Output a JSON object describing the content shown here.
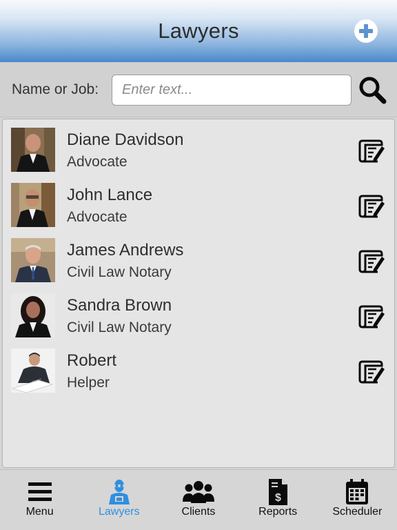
{
  "header": {
    "title": "Lawyers",
    "add_icon": "plus-circle-icon"
  },
  "search": {
    "label": "Name or Job:",
    "placeholder": "Enter text...",
    "value": "",
    "icon": "search-icon"
  },
  "lawyers": [
    {
      "name": "Diane Davidson",
      "job": "Advocate"
    },
    {
      "name": "John Lance",
      "job": "Advocate"
    },
    {
      "name": "James Andrews",
      "job": "Civil Law Notary"
    },
    {
      "name": "Sandra Brown",
      "job": "Civil Law Notary"
    },
    {
      "name": "Robert",
      "job": "Helper"
    }
  ],
  "tabs": [
    {
      "label": "Menu",
      "icon": "hamburger-menu-icon",
      "active": false
    },
    {
      "label": "Lawyers",
      "icon": "lawyer-icon",
      "active": true
    },
    {
      "label": "Clients",
      "icon": "people-group-icon",
      "active": false
    },
    {
      "label": "Reports",
      "icon": "dollar-document-icon",
      "active": false
    },
    {
      "label": "Scheduler",
      "icon": "calendar-icon",
      "active": false
    }
  ],
  "colors": {
    "accent": "#2f8fe0",
    "header_bottom": "#4a88cb",
    "panel_bg": "#e5e5e5"
  }
}
